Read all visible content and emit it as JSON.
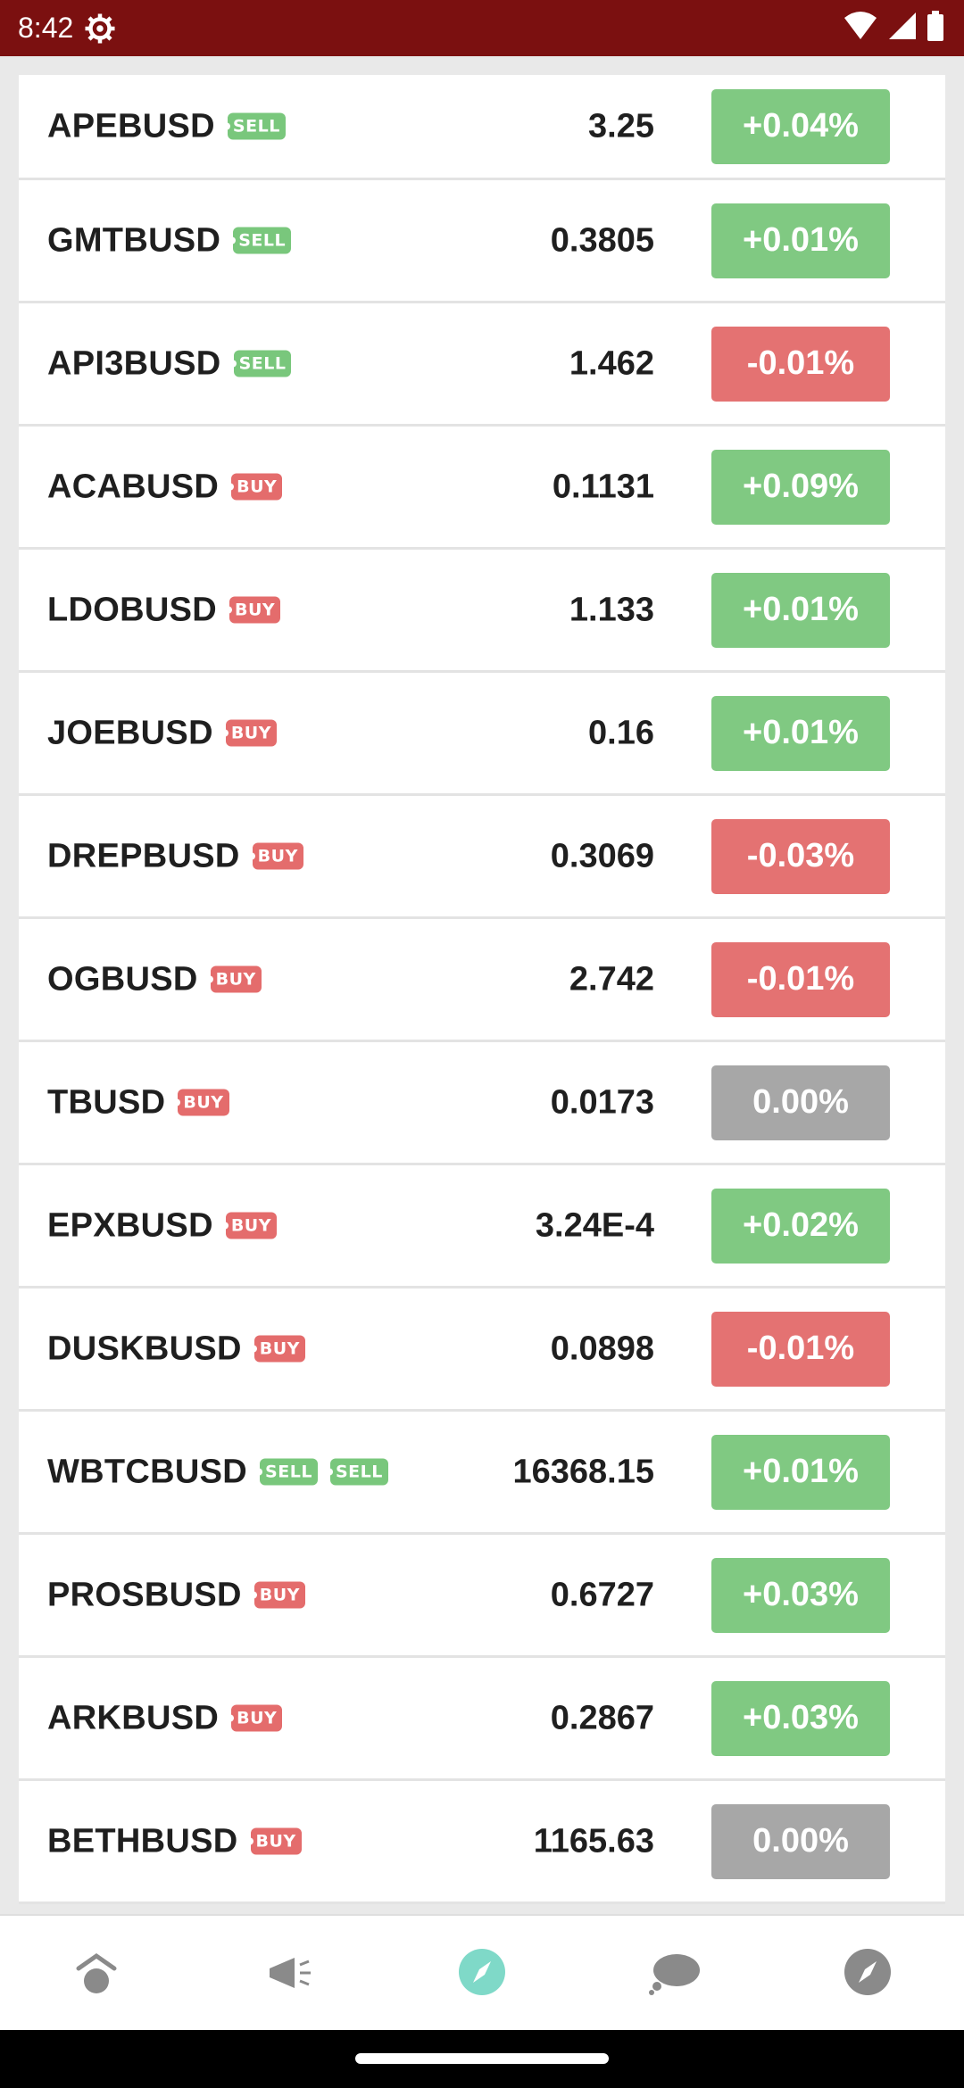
{
  "status_bar": {
    "time": "8:42"
  },
  "rows": [
    {
      "symbol": "APEBUSD",
      "tags": [
        "SELL"
      ],
      "price": "3.25",
      "change": "+0.04%",
      "trend": "up"
    },
    {
      "symbol": "GMTBUSD",
      "tags": [
        "SELL"
      ],
      "price": "0.3805",
      "change": "+0.01%",
      "trend": "up"
    },
    {
      "symbol": "API3BUSD",
      "tags": [
        "SELL"
      ],
      "price": "1.462",
      "change": "-0.01%",
      "trend": "down"
    },
    {
      "symbol": "ACABUSD",
      "tags": [
        "BUY"
      ],
      "price": "0.1131",
      "change": "+0.09%",
      "trend": "up"
    },
    {
      "symbol": "LDOBUSD",
      "tags": [
        "BUY"
      ],
      "price": "1.133",
      "change": "+0.01%",
      "trend": "up"
    },
    {
      "symbol": "JOEBUSD",
      "tags": [
        "BUY"
      ],
      "price": "0.16",
      "change": "+0.01%",
      "trend": "up"
    },
    {
      "symbol": "DREPBUSD",
      "tags": [
        "BUY"
      ],
      "price": "0.3069",
      "change": "-0.03%",
      "trend": "down"
    },
    {
      "symbol": "OGBUSD",
      "tags": [
        "BUY"
      ],
      "price": "2.742",
      "change": "-0.01%",
      "trend": "down"
    },
    {
      "symbol": "TBUSD",
      "tags": [
        "BUY"
      ],
      "price": "0.0173",
      "change": "0.00%",
      "trend": "flat"
    },
    {
      "symbol": "EPXBUSD",
      "tags": [
        "BUY"
      ],
      "price": "3.24E-4",
      "change": "+0.02%",
      "trend": "up"
    },
    {
      "symbol": "DUSKBUSD",
      "tags": [
        "BUY"
      ],
      "price": "0.0898",
      "change": "-0.01%",
      "trend": "down"
    },
    {
      "symbol": "WBTCBUSD",
      "tags": [
        "SELL",
        "SELL"
      ],
      "price": "16368.15",
      "change": "+0.01%",
      "trend": "up"
    },
    {
      "symbol": "PROSBUSD",
      "tags": [
        "BUY"
      ],
      "price": "0.6727",
      "change": "+0.03%",
      "trend": "up"
    },
    {
      "symbol": "ARKBUSD",
      "tags": [
        "BUY"
      ],
      "price": "0.2867",
      "change": "+0.03%",
      "trend": "up"
    },
    {
      "symbol": "BETHBUSD",
      "tags": [
        "BUY"
      ],
      "price": "1165.63",
      "change": "0.00%",
      "trend": "flat"
    }
  ],
  "colors": {
    "status_bar": "#7b1010",
    "up": "#80c982",
    "down": "#e47272",
    "flat": "#a7a7a7",
    "nav_active": "#7fd9c8",
    "nav_inactive": "#8a8a8a"
  },
  "bottom_nav": [
    {
      "icon": "home-icon",
      "active": false
    },
    {
      "icon": "megaphone-icon",
      "active": false
    },
    {
      "icon": "compass-icon",
      "active": true
    },
    {
      "icon": "chat-icon",
      "active": false
    },
    {
      "icon": "compass-icon",
      "active": false
    }
  ]
}
